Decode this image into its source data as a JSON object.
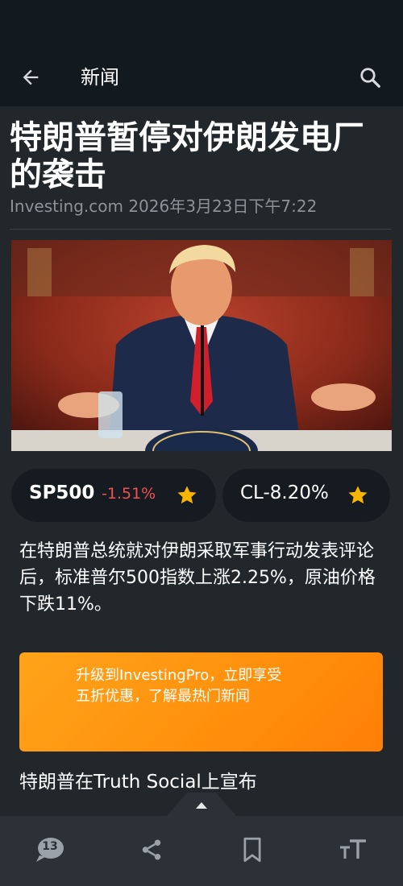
{
  "app_bar": {
    "title": "新闻",
    "back_icon": "arrow-left-icon",
    "search_icon": "search-icon"
  },
  "article": {
    "headline": "特朗普暂停对伊朗发电厂的袭击",
    "byline": "Investing.com 2026年3月23日下午7:22",
    "summary": "在特朗普总统就对伊朗采取军事行动发表评论后，标准普尔500指数上涨2.25%，原油价格下跌11%。",
    "subheading": "特朗普在Truth Social上宣布"
  },
  "tickers": [
    {
      "name": "SP500",
      "change": "-1.51%",
      "icon": "star-icon"
    },
    {
      "name": "CL",
      "change": "-8.20%",
      "icon": "star-icon"
    }
  ],
  "promo": {
    "line1": "升级到InvestingPro，立即享受",
    "line2": "五折优惠，了解最热门新闻"
  },
  "bottom_bar": {
    "comment_count": "13",
    "icons": [
      "comment-icon",
      "share-icon",
      "bookmark-icon",
      "text-size-icon"
    ]
  },
  "colors": {
    "background": "#22272c",
    "app_bar": "#121a20",
    "negative": "#f0524f",
    "star": "#f7b500",
    "promo": "#ff9a12"
  }
}
